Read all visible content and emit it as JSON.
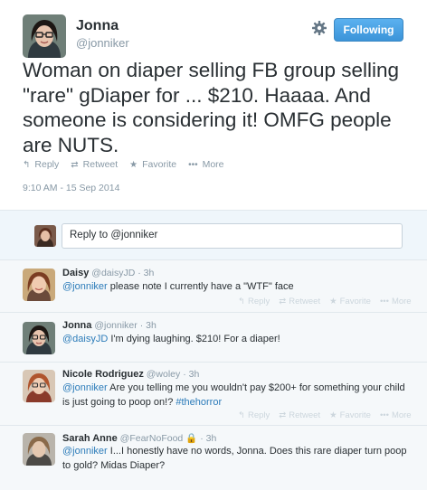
{
  "main_tweet": {
    "name": "Jonna",
    "handle": "@jonniker",
    "follow_label": "Following",
    "text": "Woman on diaper selling FB group selling \"rare\" gDiaper for ... $210. Haaaa. And someone is considering it! OMFG people are NUTS.",
    "actions": {
      "reply": "Reply",
      "retweet": "Retweet",
      "favorite": "Favorite",
      "more": "More"
    },
    "timestamp": "9:10 AM - 15 Sep 2014"
  },
  "reply_box": {
    "text": "Reply to @jonniker"
  },
  "reply_actions": {
    "reply": "Reply",
    "retweet": "Retweet",
    "favorite": "Favorite",
    "more": "More"
  },
  "replies": [
    {
      "name": "Daisy",
      "handle": "@daisyJD",
      "age": "3h",
      "mention": "@jonniker",
      "text": " please note I currently have a \"WTF\" face",
      "hashtag": ""
    },
    {
      "name": "Jonna",
      "handle": "@jonniker",
      "age": "3h",
      "mention": "@daisyJD",
      "text": " I'm dying laughing. $210! For a diaper!",
      "hashtag": ""
    },
    {
      "name": "Nicole Rodriguez",
      "handle": "@woley",
      "age": "3h",
      "mention": "@jonniker",
      "text": " Are you telling me you wouldn't pay $200+ for something your child is just going to poop on!? ",
      "hashtag": "#thehorror"
    },
    {
      "name": "Sarah Anne",
      "handle": "@FearNoFood",
      "age": "3h",
      "mention": "@jonniker",
      "text": " I...I honestly have no words, Jonna. Does this rare diaper turn poop to gold? Midas Diaper?",
      "hashtag": ""
    }
  ],
  "colors": {
    "accent": "#2b7bb9",
    "follow_button": "#3b94d9",
    "muted": "#8899a6"
  }
}
